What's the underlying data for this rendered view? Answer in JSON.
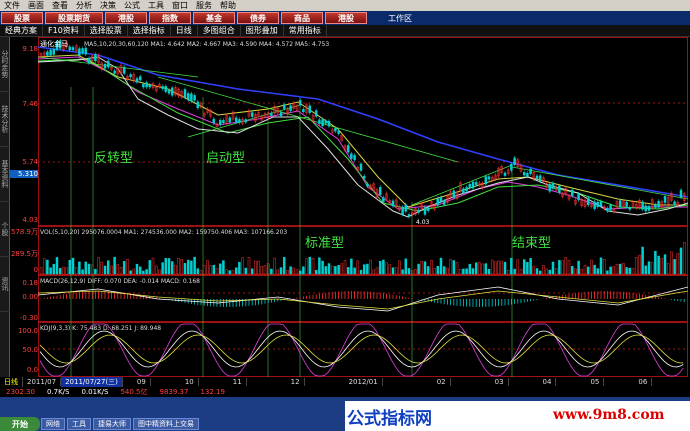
{
  "menu": [
    "文件",
    "画面",
    "查看",
    "分析",
    "决策",
    "公式",
    "工具",
    "窗口",
    "服务",
    "帮助"
  ],
  "tabs": [
    "股票",
    "股票期货",
    "港股",
    "指数",
    "基金",
    "债券",
    "商品",
    "港股"
  ],
  "workarea": "工作区",
  "toolbar": [
    "经典方案",
    "F10资料",
    "选择股票",
    "选择指标",
    "日线",
    "多图组合",
    "图形叠加",
    "常用指标"
  ],
  "stock": {
    "name": "通化金马",
    "period": "日线"
  },
  "ma_line": "MA5,10,20,30,60,120  MA1: 4.642  MA2: 4.667  MA3: 4.590  MA4: 4.572  MA5: 4.753",
  "vol_line": "VOL(5,10,20)  295076.0004  MA1: 274536.000  MA2: 159750.406  MA3: 107166.203",
  "macd_line": "MACD(26,12,9)  DIFF: 0.070  DEA: -0.014  MACD: 0.168",
  "kdj_line": "KDJ(9,3,3)  K: 75.483  D: 68.251  J: 89.948",
  "price_axis": [
    "9.18",
    "7.46",
    "5.74",
    "5.310",
    "4.03"
  ],
  "vol_axis": [
    "578.9万",
    "289.5万",
    "0"
  ],
  "macd_axis": [
    "0.18",
    "0.00",
    "-0.30"
  ],
  "kdj_axis": [
    "100.0",
    "50.0",
    "0.0"
  ],
  "annotations": [
    "反转型",
    "启动型",
    "标准型",
    "结束型"
  ],
  "lows": [
    "4.03",
    "4.03"
  ],
  "date_axis": [
    "2011/07",
    "2011/07/27(三)",
    "09",
    "10",
    "11",
    "12",
    "2012/01",
    "02",
    "03",
    "04",
    "05",
    "06"
  ],
  "bottom_tabs": [
    "指标",
    "财务",
    "BBI决策",
    "标准",
    "普通",
    "买力指标"
  ],
  "status": {
    "index1": "2302.30",
    "index2": "9839.37",
    "change": "132.19",
    "amount": "540.5亿",
    "speed": "0.7K/S",
    "speed2": "0.01K/S"
  },
  "left_labels": [
    "分时走势",
    "技术分析",
    "基本资料",
    "个股",
    "资讯"
  ],
  "taskbar": [
    "开始",
    "网络",
    "工具",
    "捷易大师",
    "图中精资料上交易"
  ],
  "banner": {
    "text": "公式指标网",
    "url": "www.9m8.com"
  },
  "colors": {
    "up": "#ff3030",
    "down": "#00d0d0",
    "ma_blue": "#3040ff"
  }
}
